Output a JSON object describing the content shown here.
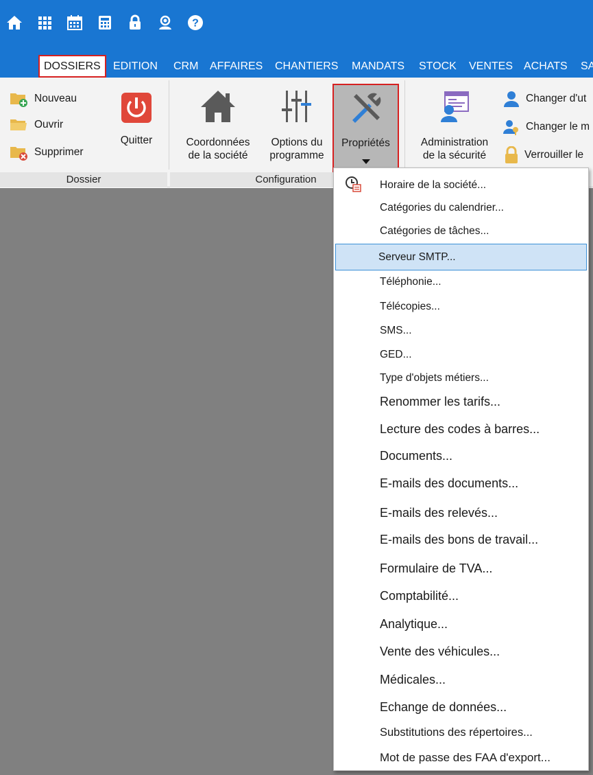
{
  "colors": {
    "accent": "#1976d2",
    "highlight_border": "#d62020",
    "menu_highlight": "#cfe3f6"
  },
  "quick_access": [
    {
      "name": "home-icon"
    },
    {
      "name": "grid-icon"
    },
    {
      "name": "calendar-icon"
    },
    {
      "name": "calculator-icon"
    },
    {
      "name": "lock-icon"
    },
    {
      "name": "support-icon"
    },
    {
      "name": "help-icon"
    }
  ],
  "menu": {
    "tabs": [
      "DOSSIERS",
      "EDITION",
      "CRM",
      "AFFAIRES",
      "CHANTIERS",
      "MANDATS",
      "STOCK",
      "VENTES",
      "ACHATS",
      "SA"
    ]
  },
  "ribbon": {
    "dossier": {
      "label": "Dossier",
      "nouveau": "Nouveau",
      "ouvrir": "Ouvrir",
      "supprimer": "Supprimer",
      "quitter": "Quitter"
    },
    "configuration": {
      "label": "Configuration",
      "coordonnees_1": "Coordonnées",
      "coordonnees_2": "de la société",
      "options_1": "Options du",
      "options_2": "programme",
      "proprietes": "Propriétés"
    },
    "securite": {
      "admin_1": "Administration",
      "admin_2": "de la sécurité",
      "changer_user": "Changer d'ut",
      "changer_mdp": "Changer le m",
      "verrouiller": "Verrouiller le"
    }
  },
  "dropdown": {
    "items": [
      "Horaire de la société...",
      "Catégories du calendrier...",
      "Catégories de tâches...",
      "Serveur SMTP...",
      "Téléphonie...",
      "Télécopies...",
      "SMS...",
      "GED...",
      "Type d'objets métiers...",
      "Renommer les tarifs...",
      "Lecture des codes à barres...",
      "Documents...",
      "E-mails des documents...",
      "E-mails des relevés...",
      "E-mails des bons de travail...",
      "Formulaire de TVA...",
      "Comptabilité...",
      "Analytique...",
      "Vente des véhicules...",
      "Médicales...",
      "Echange de données...",
      "Substitutions des répertoires...",
      "Mot de passe des FAA d'export..."
    ]
  }
}
